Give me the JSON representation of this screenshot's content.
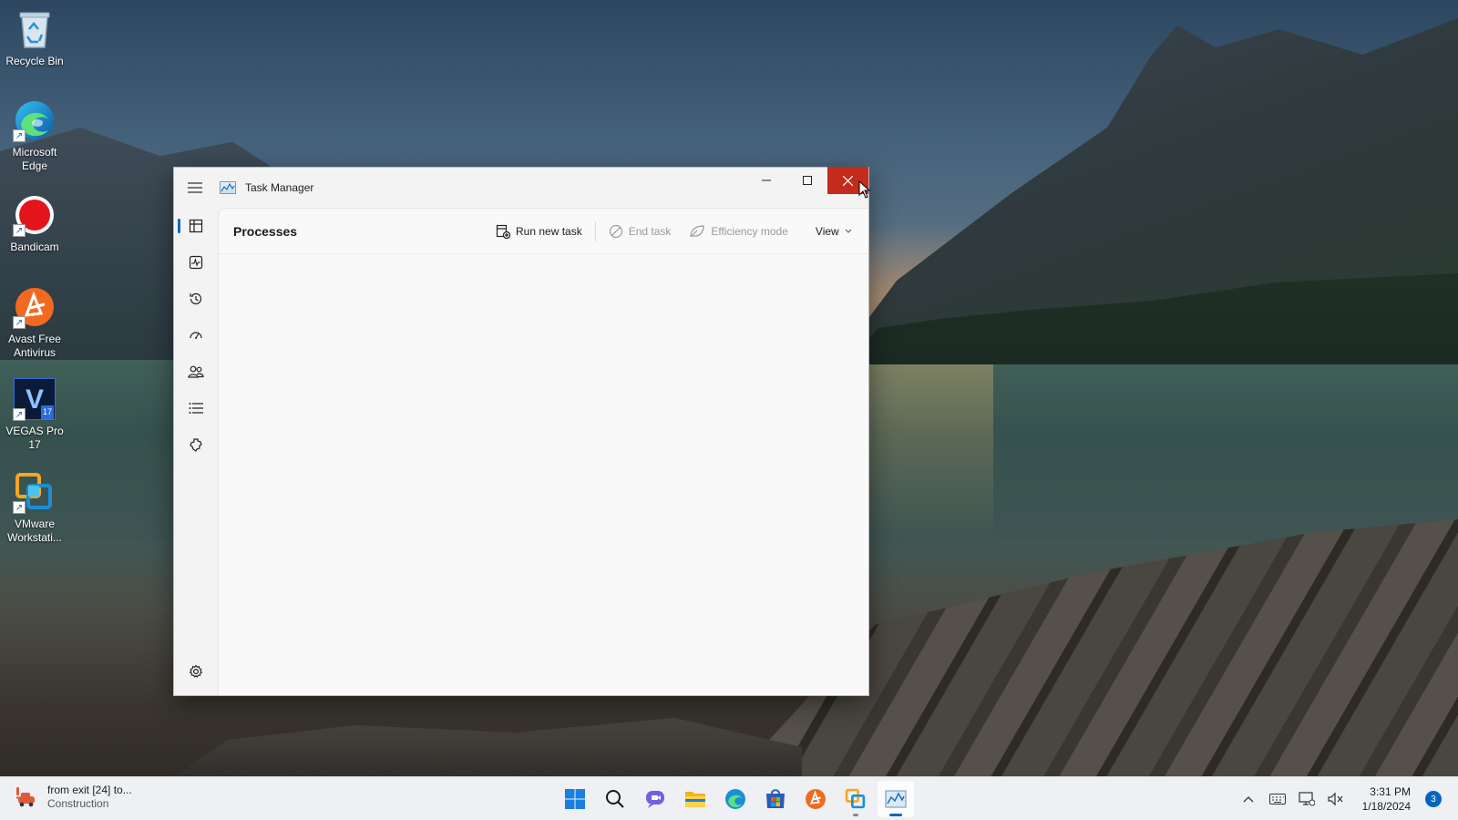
{
  "desktop": {
    "icons": [
      {
        "label": "Recycle Bin",
        "icon": "recycle-bin-icon"
      },
      {
        "label": "Microsoft Edge",
        "icon": "edge-icon"
      },
      {
        "label": "Bandicam",
        "icon": "bandicam-icon"
      },
      {
        "label": "Avast Free Antivirus",
        "icon": "avast-icon"
      },
      {
        "label": "VEGAS Pro 17",
        "icon": "vegas-icon",
        "glyph": "V",
        "badge": "17"
      },
      {
        "label": "VMware Workstati...",
        "icon": "vmware-icon"
      }
    ]
  },
  "window": {
    "title": "Task Manager",
    "controls": {
      "minimize": "–",
      "maximize": "☐",
      "close": "✕"
    },
    "sidebar": {
      "items": [
        {
          "name": "processes",
          "icon": "processes-icon",
          "active": true
        },
        {
          "name": "performance",
          "icon": "performance-icon"
        },
        {
          "name": "app-history",
          "icon": "app-history-icon"
        },
        {
          "name": "startup-apps",
          "icon": "startup-apps-icon"
        },
        {
          "name": "users",
          "icon": "users-icon"
        },
        {
          "name": "details",
          "icon": "details-icon"
        },
        {
          "name": "services",
          "icon": "services-icon"
        }
      ],
      "settings_icon": "settings-icon"
    },
    "page_title": "Processes",
    "commands": {
      "run_new_task": "Run new task",
      "end_task": "End task",
      "efficiency_mode": "Efficiency mode",
      "view": "View"
    }
  },
  "taskbar": {
    "widget": {
      "title": "from exit [24] to...",
      "subtitle": "Construction"
    },
    "apps": [
      "start-icon",
      "search-icon",
      "chat-icon",
      "file-explorer-icon",
      "edge-icon",
      "store-icon",
      "avast-icon",
      "vmware-icon",
      "task-manager-icon"
    ],
    "clock": {
      "time": "3:31 PM",
      "date": "1/18/2024"
    },
    "notification_count": "3"
  },
  "colors": {
    "accent": "#0067c0",
    "close_button": "#c42b1c",
    "window_bg": "#f3f3f3"
  }
}
